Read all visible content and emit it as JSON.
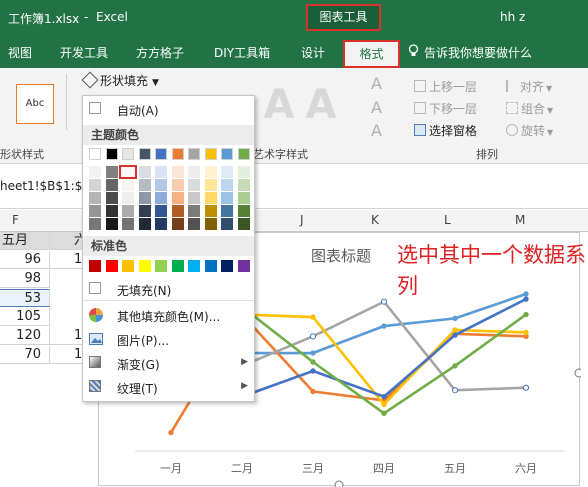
{
  "titlebar": {
    "filename": "工作簿1.xlsx",
    "separator": "-",
    "app": "Excel",
    "context_tab": "图表工具",
    "user": "hh z"
  },
  "tabs": [
    "视图",
    "开发工具",
    "方方格子",
    "DIY工具箱",
    "设计",
    "格式"
  ],
  "active_tab": "格式",
  "tell_me": "告诉我你想要做什么",
  "ribbon": {
    "abc_preview": "Abc",
    "shape_styles_label": "形状样式",
    "shape_fill_label": "形状填充",
    "wordart_label": "艺术字样式",
    "wordart_glyph": "A",
    "arrange": {
      "bring_forward": "上移一层",
      "send_backward": "下移一层",
      "selection_pane": "选择窗格",
      "align": "对齐",
      "group": "组合",
      "rotate": "旋转",
      "label": "排列"
    }
  },
  "formula": {
    "text": "heet1!$B$1:$G"
  },
  "columns": [
    "F",
    "J",
    "K",
    "L",
    "M"
  ],
  "cells": {
    "header": "五月",
    "header_next": "六",
    "values": [
      "96",
      "98",
      "53",
      "105",
      "120",
      "70"
    ],
    "trailing": [
      "1",
      "",
      "",
      "",
      "1",
      "1"
    ]
  },
  "dropdown": {
    "auto": "自动(A)",
    "theme_colors": "主题颜色",
    "standard_colors": "标准色",
    "no_fill": "无填充(N)",
    "more_colors": "其他填充颜色(M)...",
    "picture": "图片(P)...",
    "gradient": "渐变(G)",
    "texture": "纹理(T)",
    "theme_top": [
      "#ffffff",
      "#000000",
      "#e7e6e6",
      "#44546a",
      "#4472c4",
      "#ed7d31",
      "#a5a5a5",
      "#ffc000",
      "#5b9bd5",
      "#70ad47"
    ],
    "standard": [
      "#c00000",
      "#ff0000",
      "#ffc000",
      "#ffff00",
      "#92d050",
      "#00b050",
      "#00b0f0",
      "#0070c0",
      "#002060",
      "#7030a0"
    ]
  },
  "chart_data": {
    "type": "line",
    "title": "图表标题",
    "categories": [
      "一月",
      "二月",
      "三月",
      "四月",
      "五月",
      "六月"
    ],
    "series": [
      {
        "color": "#5b9bd5",
        "values": [
          null,
          82,
          82,
          103,
          109,
          128
        ]
      },
      {
        "color": "#ed7d31",
        "values": [
          20,
          112,
          52,
          45,
          97,
          95
        ]
      },
      {
        "color": "#a5a5a5",
        "values": [
          null,
          72,
          95,
          122,
          53,
          55
        ]
      },
      {
        "color": "#ffc000",
        "values": [
          null,
          112,
          110,
          42,
          100,
          98
        ]
      },
      {
        "color": "#4472c4",
        "values": [
          null,
          48,
          68,
          48,
          96,
          124
        ]
      },
      {
        "color": "#70ad47",
        "values": [
          null,
          118,
          75,
          35,
          72,
          112
        ]
      }
    ]
  },
  "annotation": "选中其中一个数据系列"
}
